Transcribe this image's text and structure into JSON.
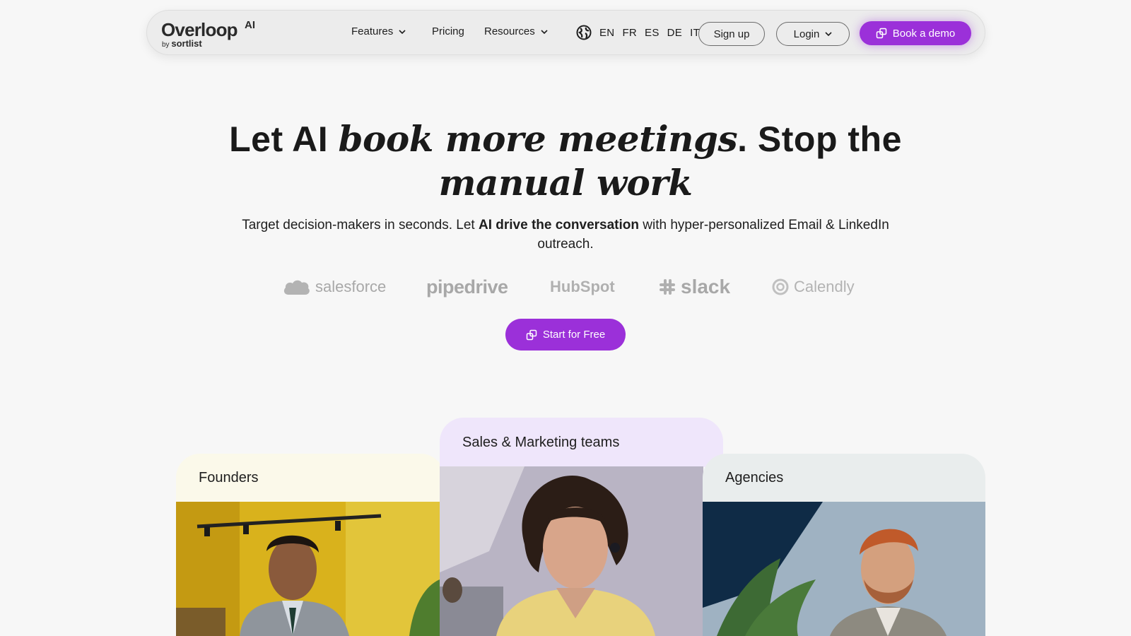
{
  "brand": {
    "name": "Overloop",
    "suffix": "AI",
    "by_prefix": "by",
    "by_name": "sortlist"
  },
  "nav": {
    "features": "Features",
    "pricing": "Pricing",
    "resources": "Resources",
    "languages": [
      "EN",
      "FR",
      "ES",
      "DE",
      "IT"
    ],
    "signup": "Sign up",
    "login": "Login",
    "book_demo": "Book a demo"
  },
  "hero": {
    "title_part1": "Let AI ",
    "title_emph1": "book more meetings",
    "title_part2": ". Stop the",
    "title_emph2": "manual work",
    "subtitle_part1": "Target decision-makers in seconds. Let ",
    "subtitle_bold": "AI drive the conversation",
    "subtitle_part2": " with hyper-personalized Email & LinkedIn outreach.",
    "cta": "Start for Free"
  },
  "integrations": [
    "salesforce",
    "pipedrive",
    "HubSpot",
    "slack",
    "Calendly"
  ],
  "audiences": {
    "founders": "Founders",
    "sales": "Sales & Marketing teams",
    "agencies": "Agencies"
  },
  "colors": {
    "accent": "#9b30d9",
    "background": "#f7f7f7",
    "founders_tab": "#fbf9ea",
    "sales_tab": "#efe6fb",
    "agencies_tab": "#e9eded"
  }
}
